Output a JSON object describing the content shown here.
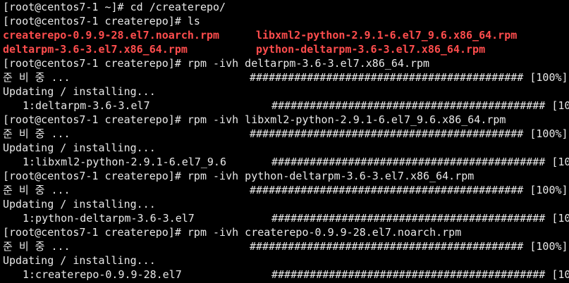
{
  "terminal": {
    "prompt_home": "[root@centos7-1 ~]# ",
    "prompt_repo": "[root@centos7-1 createrepo]# ",
    "cmd_cd": "cd /createrepo/",
    "cmd_ls": "ls",
    "ls_output": [
      "createrepo-0.9.9-28.el7.noarch.rpm",
      "libxml2-python-2.9.1-6.el7_9.6.x86_64.rpm",
      "deltarpm-3.6-3.el7.x86_64.rpm",
      "python-deltarpm-3.6-3.el7.x86_64.rpm"
    ],
    "ls_color": "#ff4d4d",
    "preparing_label": "준 비 중 ...",
    "progress_bar": "########################################### [100%]",
    "updating_label": "Updating / installing...",
    "installs": [
      {
        "cmd": "rpm -ivh deltarpm-3.6-3.el7.x86_64.rpm",
        "pkg": "1:deltarpm-3.6-3.el7"
      },
      {
        "cmd": "rpm -ivh libxml2-python-2.9.1-6.el7_9.6.x86_64.rpm",
        "pkg": "1:libxml2-python-2.9.1-6.el7_9.6"
      },
      {
        "cmd": "rpm -ivh python-deltarpm-3.6-3.el7.x86_64.rpm",
        "pkg": "1:python-deltarpm-3.6-3.el7"
      },
      {
        "cmd": "rpm -ivh createrepo-0.9.9-28.el7.noarch.rpm",
        "pkg": "1:createrepo-0.9.9-28.el7"
      }
    ]
  }
}
